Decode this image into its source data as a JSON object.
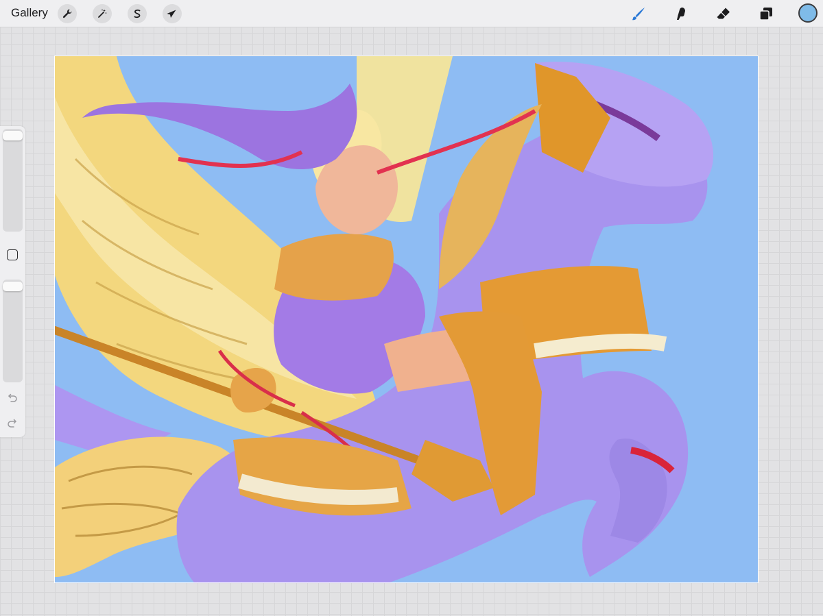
{
  "topbar": {
    "gallery_label": "Gallery",
    "left_tools": [
      {
        "name": "actions",
        "icon": "wrench-icon"
      },
      {
        "name": "adjustments",
        "icon": "magic-wand-icon"
      },
      {
        "name": "selection",
        "icon": "selection-s-icon"
      },
      {
        "name": "transform",
        "icon": "arrow-cursor-icon"
      }
    ],
    "right_tools": [
      {
        "name": "brush",
        "icon": "brush-icon",
        "active": true
      },
      {
        "name": "smudge",
        "icon": "smudge-icon"
      },
      {
        "name": "eraser",
        "icon": "eraser-icon"
      },
      {
        "name": "layers",
        "icon": "layers-icon"
      }
    ],
    "current_color": "#7fbbe8",
    "active_tool_color": "#2a78d6"
  },
  "sidebar": {
    "brush_size_level": 0.02,
    "opacity_level": 0.02,
    "undo_icon": "undo-icon",
    "redo_icon": "redo-icon",
    "modify_icon": "square-icon"
  },
  "canvas": {
    "background_color": "#8ebcf3",
    "content": "artwork-illustration"
  }
}
